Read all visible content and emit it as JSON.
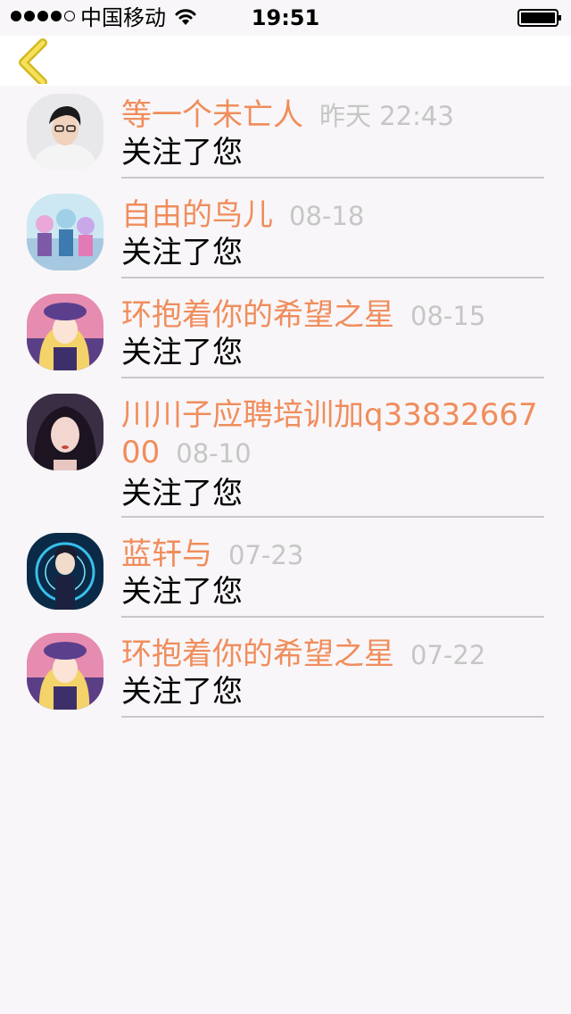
{
  "status_bar": {
    "carrier": "中国移动",
    "time": "19:51"
  },
  "nav": {
    "back_icon": "chevron-left-icon",
    "accent_color": "#f2dc45"
  },
  "colors": {
    "name": "#f08d5c",
    "time": "#c6c6c6",
    "action": "#000000",
    "divider": "#c8c8c8",
    "background": "#f8f6f8"
  },
  "notifications": [
    {
      "name": "等一个未亡人",
      "time": "昨天 22:43",
      "action": "关注了您",
      "avatar": "avatar-male-portrait"
    },
    {
      "name": "自由的鸟儿",
      "time": "08-18",
      "action": "关注了您",
      "avatar": "avatar-anime-group"
    },
    {
      "name": "环抱着你的希望之星",
      "time": "08-15",
      "action": "关注了您",
      "avatar": "avatar-anime-girl"
    },
    {
      "name": "川川子应聘培训加q3383266700",
      "time": "08-10",
      "action": "关注了您",
      "avatar": "avatar-female-portrait"
    },
    {
      "name": "蓝轩与",
      "time": "07-23",
      "action": "关注了您",
      "avatar": "avatar-anime-boy"
    },
    {
      "name": "环抱着你的希望之星",
      "time": "07-22",
      "action": "关注了您",
      "avatar": "avatar-anime-girl"
    }
  ]
}
